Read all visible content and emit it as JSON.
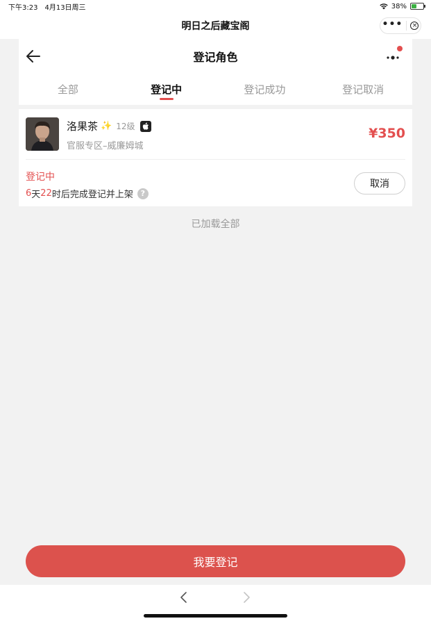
{
  "status_bar": {
    "time": "下午3:23",
    "date": "4月13日周三",
    "battery": "38%"
  },
  "miniprogram": {
    "title": "明日之后藏宝阁"
  },
  "page": {
    "title": "登记角色"
  },
  "tabs": [
    {
      "label": "全部",
      "active": false
    },
    {
      "label": "登记中",
      "active": true
    },
    {
      "label": "登记成功",
      "active": false
    },
    {
      "label": "登记取消",
      "active": false
    }
  ],
  "card": {
    "character_name": "洛果茶",
    "sparkle": "✨",
    "level": "12级",
    "server": "官服专区–威廉姆城",
    "price": "¥350",
    "status": "登记中",
    "remain_days": "6",
    "remain_days_unit": "天",
    "remain_hours": "22",
    "remain_suffix": "时后完成登记并上架",
    "help": "?",
    "cancel_label": "取消"
  },
  "list_footer": "已加载全部",
  "register_button": "我要登记",
  "colors": {
    "accent": "#e34f4f",
    "button": "#dc524d",
    "background": "#f2f2f2"
  }
}
